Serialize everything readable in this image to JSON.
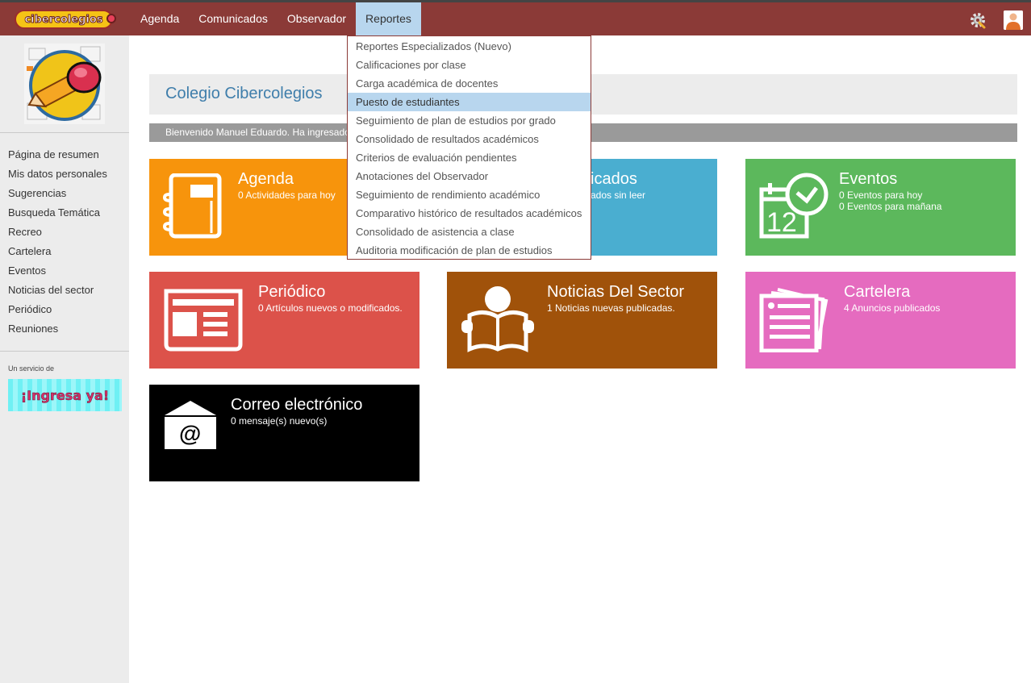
{
  "header": {
    "logo_text": "cibercolegios",
    "nav": [
      "Agenda",
      "Comunicados",
      "Observador",
      "Reportes"
    ],
    "active_nav": "Reportes",
    "icons": [
      "gear-icon",
      "user-avatar-icon"
    ]
  },
  "sidebar": {
    "school_logo": "school-crest-pencil-image",
    "items": [
      "Página de resumen",
      "Mis datos personales",
      "Sugerencias",
      "Busqueda Temática",
      "Recreo",
      "Cartelera",
      "Eventos",
      "Noticias del sector",
      "Periódico",
      "Reuniones"
    ],
    "servicio_label": "Un servicio de",
    "banner_text": "¡Ingresa ya!"
  },
  "main": {
    "school_title": "Colegio Cibercolegios",
    "welcome": "Bienvenido Manuel Eduardo. Ha ingresado",
    "tiles": {
      "agenda": {
        "title": "Agenda",
        "sub": [
          "0 Actividades para hoy"
        ],
        "color": "#f7940c",
        "icon": "notebook-icon"
      },
      "comunicados": {
        "title": "icados",
        "sub": [
          "ados sin leer"
        ],
        "color": "#4aaed0"
      },
      "eventos": {
        "title": "Eventos",
        "sub": [
          "0 Eventos para hoy",
          "0 Eventos para mañana"
        ],
        "color": "#5cb85c",
        "icon": "calendar-clock-icon"
      },
      "periodico": {
        "title": "Periódico",
        "sub": [
          "0 Artículos nuevos o modificados."
        ],
        "color": "#dc524a",
        "icon": "newspaper-icon"
      },
      "noticias": {
        "title": "Noticias Del Sector",
        "sub": [
          "1 Noticias nuevas publicadas."
        ],
        "color": "#a0520a",
        "icon": "reader-icon"
      },
      "cartelera": {
        "title": "Cartelera",
        "sub": [
          "4 Anuncios publicados"
        ],
        "color": "#e56bbf",
        "icon": "notes-icon"
      },
      "correo": {
        "title": "Correo electrónico",
        "sub": [
          "0 mensaje(s) nuevo(s)"
        ],
        "color": "#000000",
        "icon": "envelope-icon"
      }
    }
  },
  "reportes_menu": {
    "items": [
      "Reportes Especializados (Nuevo)",
      "Calificaciones por clase",
      "Carga académica de docentes",
      "Puesto de estudiantes",
      "Seguimiento de plan de estudios por grado",
      "Consolidado de resultados académicos",
      "Criterios de evaluación pendientes",
      "Anotaciones del Observador",
      "Seguimiento de rendimiento académico",
      "Comparativo histórico de resultados académicos",
      "Consolidado de asistencia a clase",
      "Auditoria modificación de plan de estudios"
    ],
    "highlighted": "Puesto de estudiantes"
  }
}
